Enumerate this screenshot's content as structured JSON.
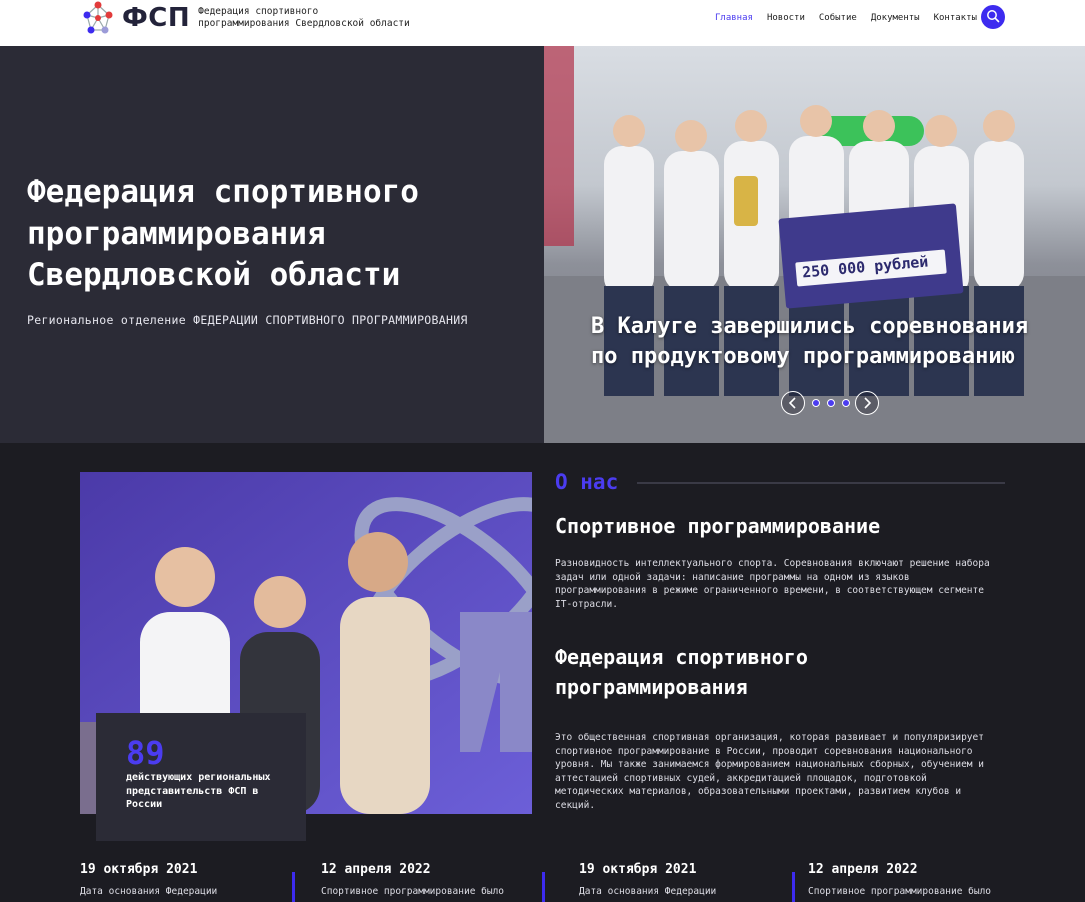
{
  "header": {
    "logo_abbr": "ФСП",
    "logo_line1": "Федерация спортивного",
    "logo_line2": "программирования Свердловской области",
    "nav": [
      "Главная",
      "Новости",
      "Событие",
      "Документы",
      "Контакты"
    ],
    "active_nav": "Главная",
    "accent_color": "#3d2bef"
  },
  "hero": {
    "title": "Федерация спортивного программирования Свердловской области",
    "subtitle": "Региональное отделение ФЕДЕРАЦИИ СПОРТИВНОГО ПРОГРАММИРОВАНИЯ",
    "slider": {
      "caption": "В Калуге завершились соревнования по продуктовому программированию",
      "certificate_text": "250 000 рублей",
      "dots": 3,
      "prev_icon": "chevron-left-icon",
      "next_icon": "chevron-right-icon"
    }
  },
  "about": {
    "heading": "О нас",
    "section1_title": "Спортивное программирование",
    "section1_text": "Разновидность интеллектуального спорта. Соревнования включают решение набора задач или одной задачи: написание программы на одном из языков программирования в режиме ограниченного времени, в соответствующем сегменте IT-отрасли.",
    "section2_title": "Федерация спортивного программирования",
    "section2_text": "Это общественная спортивная организация, которая развивает и популяризирует спортивное программирование в России, проводит соревнования национального уровня. Мы также занимаемся формированием национальных сборных, обучением и аттестацией спортивных судей, аккредитацией площадок, подготовкой методических материалов, образовательными проектами, развитием клубов и секций.",
    "stat_value": "89",
    "stat_label": "действующих региональных представительств ФСП в России"
  },
  "timeline": [
    {
      "date": "19 октября 2021",
      "text": "Дата основания Федерации"
    },
    {
      "date": "12 апреля 2022",
      "text": "Спортивное программирование было"
    },
    {
      "date": "19 октября 2021",
      "text": "Дата основания Федерации"
    },
    {
      "date": "12 апреля 2022",
      "text": "Спортивное программирование было"
    }
  ]
}
